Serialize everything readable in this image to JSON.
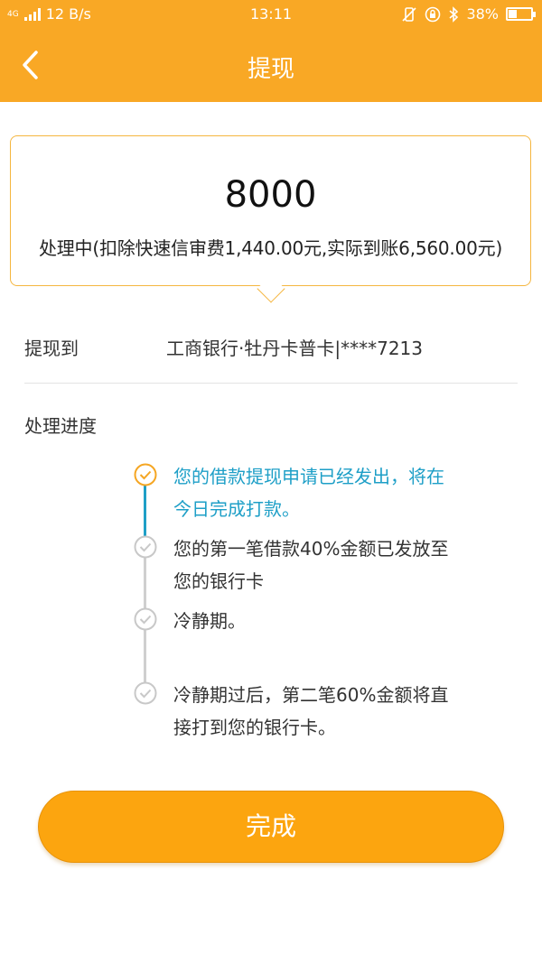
{
  "status_bar": {
    "network": "4G",
    "speed": "12 B/s",
    "time": "13:11",
    "battery": "38%"
  },
  "header": {
    "title": "提现",
    "background": "#f9a825"
  },
  "card": {
    "amount": "8000",
    "status": "处理中(扣除快速信审费1,440.00元,实际到账6,560.00元)"
  },
  "withdraw_to": {
    "label": "提现到",
    "value": "工商银行·牡丹卡普卡|****7213"
  },
  "progress": {
    "label": "处理进度",
    "steps": [
      {
        "line1": "您的借款提现申请已经发出，将在",
        "line2": "今日完成打款。",
        "active": true
      },
      {
        "line1": "您的第一笔借款40%金额已发放至",
        "line2": "您的银行卡",
        "active": false
      },
      {
        "line1": "冷静期。",
        "line2": "",
        "active": false
      },
      {
        "line1": "冷静期过后，第二笔60%金额将直",
        "line2": "接打到您的银行卡。",
        "active": false
      }
    ],
    "active_color": "#1e9fc7"
  },
  "done_button": {
    "label": "完成",
    "color": "#fca50f"
  }
}
